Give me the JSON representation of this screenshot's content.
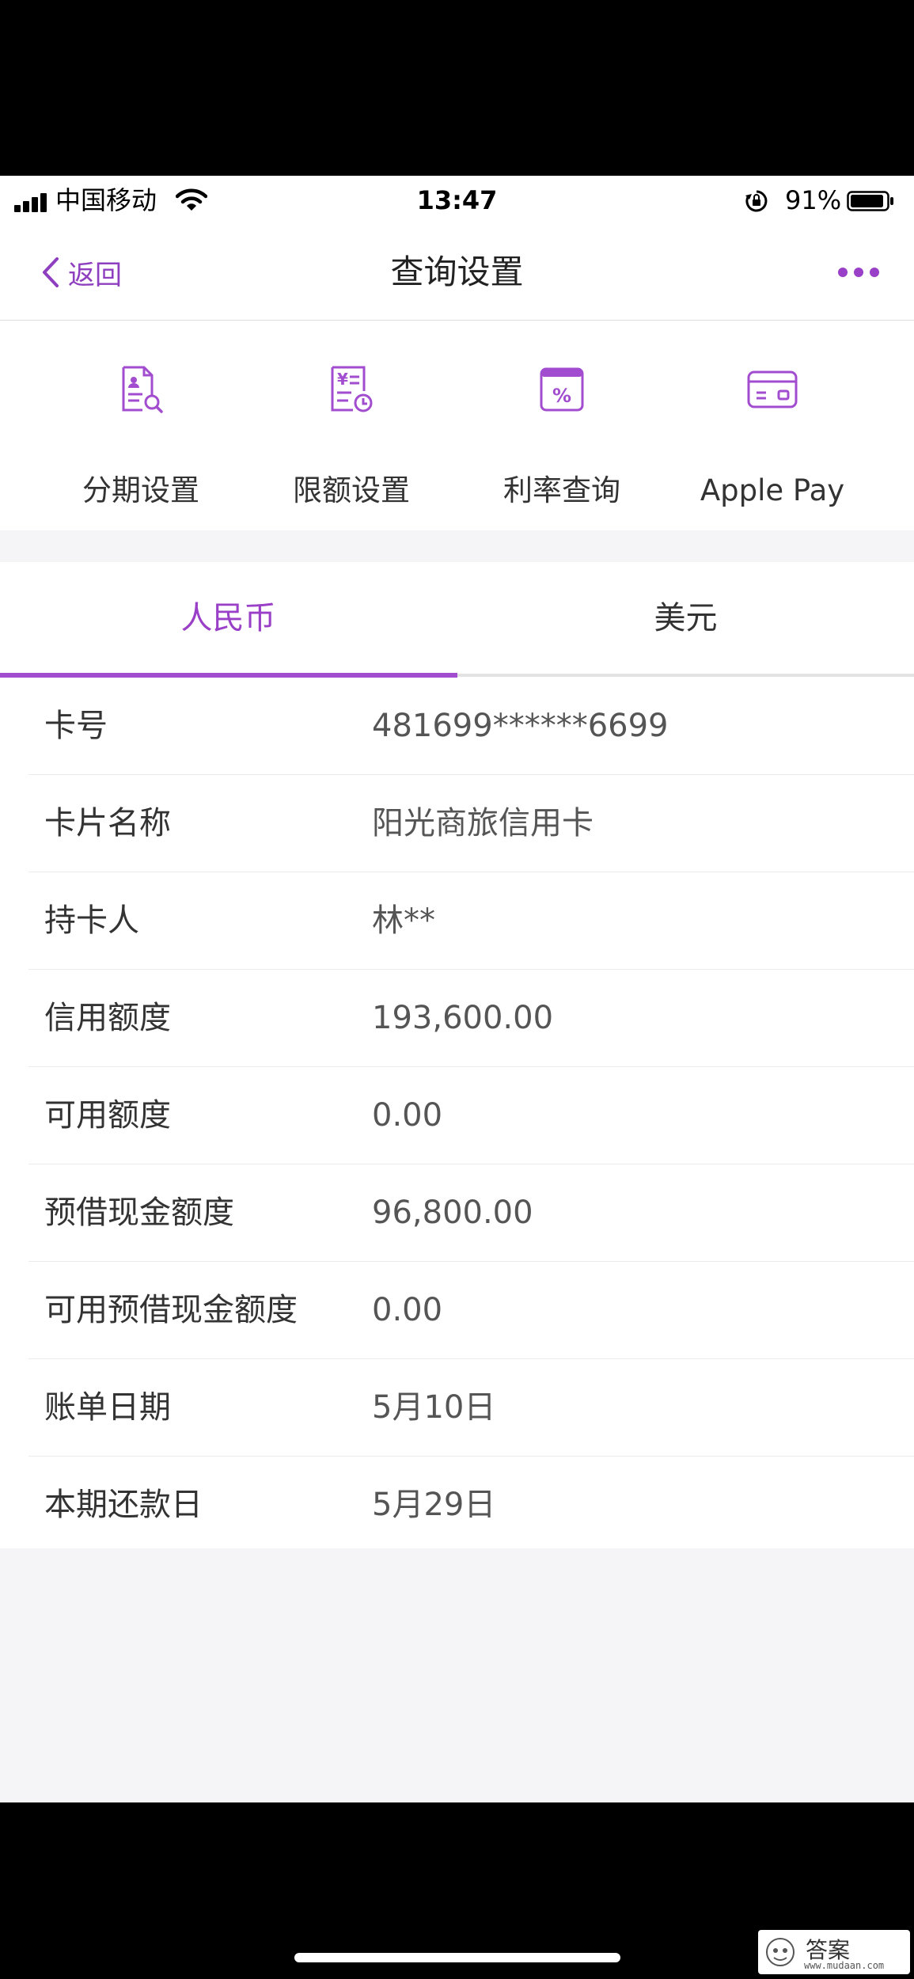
{
  "status_bar": {
    "carrier": "中国移动",
    "time": "13:47",
    "battery_percent": "91%"
  },
  "nav": {
    "back_label": "返回",
    "title": "查询设置"
  },
  "quick_actions": [
    {
      "label": "分期设置",
      "icon": "installment-doc-icon"
    },
    {
      "label": "限额设置",
      "icon": "limit-yen-clock-icon"
    },
    {
      "label": "利率查询",
      "icon": "percent-calendar-icon"
    },
    {
      "label": "Apple Pay",
      "icon": "card-icon"
    }
  ],
  "tabs": [
    {
      "label": "人民币",
      "active": true
    },
    {
      "label": "美元",
      "active": false
    }
  ],
  "info": [
    {
      "label": "卡号",
      "value": "481699******6699"
    },
    {
      "label": "卡片名称",
      "value": "阳光商旅信用卡"
    },
    {
      "label": "持卡人",
      "value": "林**"
    },
    {
      "label": "信用额度",
      "value": "193,600.00"
    },
    {
      "label": "可用额度",
      "value": "0.00"
    },
    {
      "label": "预借现金额度",
      "value": "96,800.00"
    },
    {
      "label": "可用预借现金额度",
      "value": "0.00"
    },
    {
      "label": "账单日期",
      "value": "5月10日"
    },
    {
      "label": "本期还款日",
      "value": "5月29日"
    }
  ],
  "watermark": {
    "text": "答案",
    "sub": "www.mudaan.com"
  },
  "colors": {
    "accent": "#9a3fc7",
    "text": "#333333"
  }
}
